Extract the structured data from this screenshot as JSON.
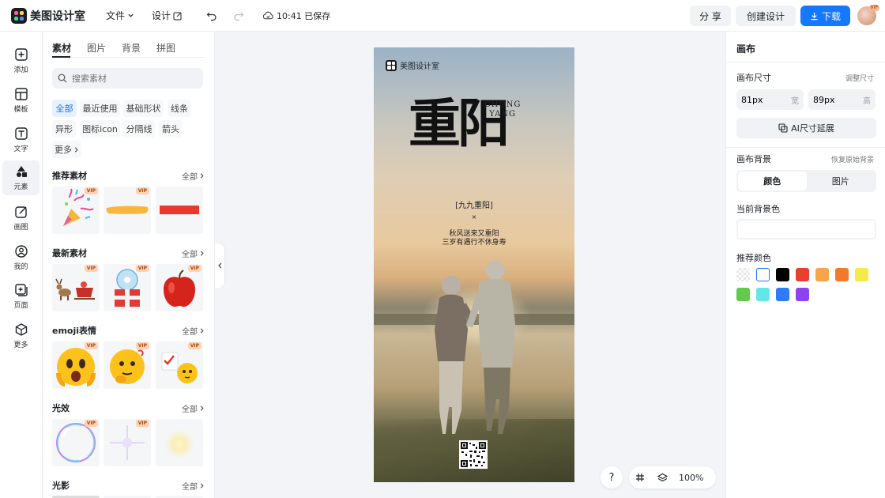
{
  "app": {
    "name": "美图设计室"
  },
  "topbar": {
    "file_label": "文件",
    "design_label": "设计",
    "save_status": "10:41 已保存",
    "share_label": "分 享",
    "create_label": "创建设计",
    "download_label": "下载",
    "avatar_badge": "VIP"
  },
  "leftnav": {
    "items": [
      {
        "label": "添加",
        "icon": "plus-square-icon"
      },
      {
        "label": "模板",
        "icon": "template-icon"
      },
      {
        "label": "文字",
        "icon": "text-icon"
      },
      {
        "label": "元素",
        "icon": "shapes-icon",
        "active": true
      },
      {
        "label": "画图",
        "icon": "edit-icon"
      },
      {
        "label": "我的",
        "icon": "user-icon"
      },
      {
        "label": "页面",
        "icon": "add-page-icon"
      },
      {
        "label": "更多",
        "icon": "cube-icon"
      }
    ]
  },
  "panel": {
    "tabs": [
      "素材",
      "图片",
      "背景",
      "拼图"
    ],
    "search_placeholder": "搜索素材",
    "chips": [
      "全部",
      "最近使用",
      "基础形状",
      "线条",
      "异形",
      "图标icon",
      "分隔线",
      "箭头",
      "更多"
    ],
    "all_label": "全部",
    "vip": "VIP",
    "sections": [
      {
        "title": "推荐素材"
      },
      {
        "title": "最新素材"
      },
      {
        "title": "emoji表情"
      },
      {
        "title": "光效"
      },
      {
        "title": "光影"
      }
    ]
  },
  "canvas_content": {
    "logo_text": "美图设计室",
    "title": "重阳",
    "pinyin_1": "CHONG",
    "pinyin_2": "YANG",
    "subtitle": "[九九重阳]",
    "separator": "×",
    "line_1": "秋风送来又重阳",
    "line_2": "三岁有遇行不休身寿"
  },
  "bottom": {
    "help": "?",
    "zoom": "100%"
  },
  "right": {
    "header": "画布",
    "size_label": "画布尺寸",
    "adjust_size": "调整尺寸",
    "width_value": "81px",
    "width_unit": "宽",
    "height_value": "89px",
    "height_unit": "高",
    "ai_button": "AI尺寸延展",
    "bg_label": "画布背景",
    "restore_bg": "恢复原始背景",
    "seg_color": "颜色",
    "seg_image": "图片",
    "current_color_label": "当前背景色",
    "recommended_label": "推荐颜色",
    "swatches": [
      "transparent",
      "#ffffff",
      "#000000",
      "#e8402d",
      "#f6a54b",
      "#f07a2a",
      "#f6e94a",
      "#62cb4b",
      "#62e6e8",
      "#2f7cf6",
      "#8a45f0"
    ]
  }
}
